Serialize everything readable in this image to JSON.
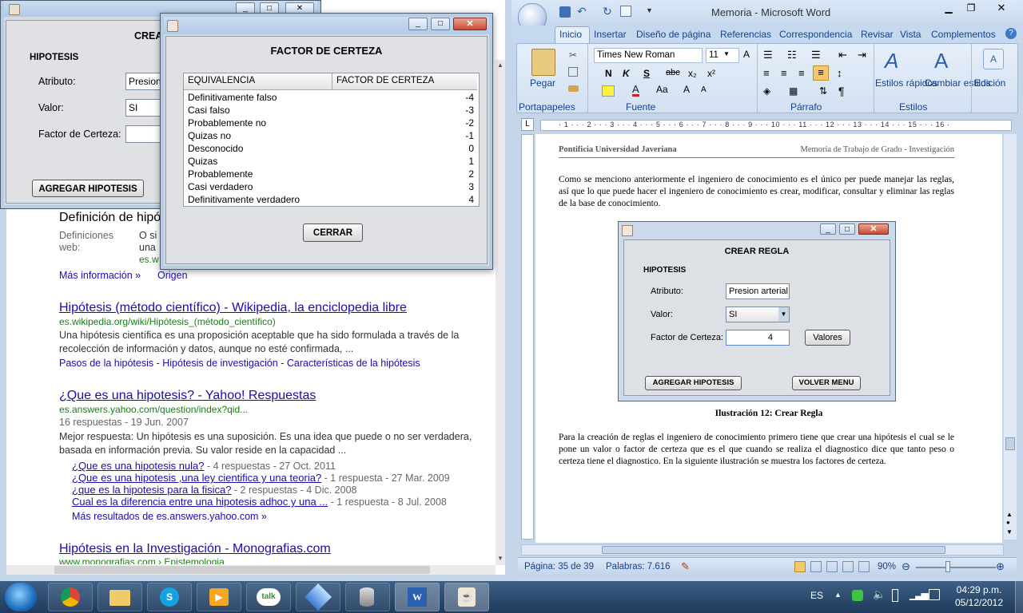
{
  "browser": {
    "def_title": "Definición de hipó",
    "def_label": "Definiciones web:",
    "def_snip1": "O si",
    "def_snip2": "una",
    "def_url": "es.w",
    "more_info": "Más información »",
    "origin": "Origen",
    "results": [
      {
        "title": "Hipótesis (método científico) - Wikipedia, la enciclopedia libre",
        "url": "es.wikipedia.org/wiki/Hipótesis_(método_científico)",
        "snippet": "Una hipótesis científica es una proposición aceptable que ha sido formulada a través de la recolección de información y datos, aunque no esté confirmada, ...",
        "links": "Pasos de la hipótesis - Hipótesis de investigación - Características de la hipótesis"
      },
      {
        "title": "¿Que es una hipotesis? - Yahoo! Respuestas",
        "url": "es.answers.yahoo.com/question/index?qid...",
        "meta": "16 respuestas - 19 Jun. 2007",
        "snippet": "Mejor respuesta: Un hipótesis es una suposición. Es una idea que puede o no ser verdadera, basada en información previa. Su valor reside en la capacidad ...",
        "sub": [
          {
            "text": "¿Que es una hipotesis nula?",
            "meta": " - 4 respuestas - 27 Oct. 2011"
          },
          {
            "text": "¿Que es una hipotesis ,una ley cientifica y una teoria?",
            "meta": " - 1 respuesta - 27 Mar. 2009"
          },
          {
            "text": "¿que es la hipotesis para la fisica?",
            "meta": " - 2 respuestas - 4 Dic. 2008"
          },
          {
            "text": "Cual es la diferencia entre una hipotesis adhoc y una ...",
            "meta": " - 1 respuesta - 8 Jul. 2008"
          }
        ],
        "more": "Más resultados de es.answers.yahoo.com »"
      },
      {
        "title": "Hipótesis en la Investigación - Monografias.com",
        "url": "www.monografias.com › Epistemologia"
      }
    ]
  },
  "crear_regla_back": {
    "title_partial": "CREA",
    "section": "HIPOTESIS",
    "attr_label": "Atributo:",
    "attr_value": "Presion",
    "valor_label": "Valor:",
    "valor_value": "SI",
    "fc_label": "Factor de Certeza:",
    "add_button": "AGREGAR HIPOTESIS"
  },
  "factor_dialog": {
    "title": "FACTOR DE CERTEZA",
    "col1": "EQUIVALENCIA",
    "col2": "FACTOR DE CERTEZA",
    "rows": [
      {
        "label": "Definitivamente falso",
        "value": "-4"
      },
      {
        "label": "Casi falso",
        "value": "-3"
      },
      {
        "label": "Probablemente no",
        "value": "-2"
      },
      {
        "label": "Quizas no",
        "value": "-1"
      },
      {
        "label": "Desconocido",
        "value": "0"
      },
      {
        "label": "Quizas",
        "value": "1"
      },
      {
        "label": "Probablemente",
        "value": "2"
      },
      {
        "label": "Casi verdadero",
        "value": "3"
      },
      {
        "label": "Definitivamente verdadero",
        "value": "4"
      }
    ],
    "close_button": "CERRAR"
  },
  "word": {
    "window_title": "Memoria - Microsoft Word",
    "tabs": [
      "Inicio",
      "Insertar",
      "Diseño de página",
      "Referencias",
      "Correspondencia",
      "Revisar",
      "Vista",
      "Complementos"
    ],
    "font_name": "Times New Roman",
    "font_size": "11",
    "paste": "Pegar",
    "groups": [
      "Portapapeles",
      "Fuente",
      "Párrafo",
      "Estilos"
    ],
    "styles_quick": "Estilos rápidos",
    "styles_change": "Cambiar estilos",
    "edition": "Edición",
    "ruler": "· 1 · · · 2 · · · 3 · · · 4 · · · 5 · · · 6 · · · 7 · · · 8 · · · 9 · · · 10 · · · 11 · · · 12 · · · 13 · · · 14 · · · 15 · · · 16 ·",
    "header_left": "Pontificia Universidad Javeriana",
    "header_right": "Memoria de Trabajo de Grado - Investigación",
    "para1": "Como se menciono anteriormente el ingeniero de conocimiento es el único per puede manejar las reglas, así que lo que puede hacer el ingeniero de conocimiento es crear, modificar, consultar y eliminar las reglas de la base de conocimiento.",
    "figure": {
      "title": "CREAR REGLA",
      "section": "HIPOTESIS",
      "attr_label": "Atributo:",
      "attr_value": "Presion arterial",
      "valor_label": "Valor:",
      "valor_value": "SI",
      "fc_label": "Factor de Certeza:",
      "fc_value": "4",
      "valores_button": "Valores",
      "add_button": "AGREGAR HIPOTESIS",
      "back_button": "VOLVER MENU"
    },
    "caption": "Ilustración 12: Crear Regla",
    "para2": "Para la creación de reglas el ingeniero de conocimiento primero tiene que crear una hipótesis el cual se le pone un valor o factor de certeza que es el que cuando se realiza el diagnostico dice que tanto peso o certeza tiene el diagnostico. En la siguiente ilustración se muestra los factores de certeza.",
    "status_page": "Página: 35 de 39",
    "status_words": "Palabras: 7.616",
    "zoom": "90%"
  },
  "taskbar": {
    "lang": "ES",
    "time": "04:29 p.m.",
    "date": "05/12/2012"
  }
}
